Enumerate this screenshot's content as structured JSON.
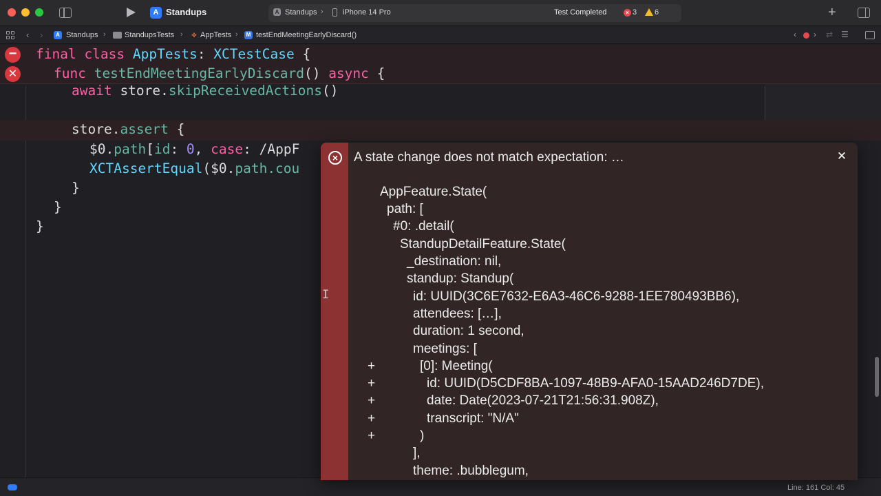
{
  "titlebar": {
    "project": "Standups",
    "scheme": "Standups",
    "device": "iPhone 14 Pro",
    "status": "Test Completed",
    "errors": "3",
    "warnings": "6"
  },
  "jumpbar": {
    "crumbs": [
      "Standups",
      "StandupsTests",
      "AppTests",
      "testEndMeetingEarlyDiscard()"
    ]
  },
  "code": {
    "line1": {
      "kw": "final class ",
      "type": "AppTests",
      "colon": ": ",
      "super": "XCTestCase",
      "brace": " {"
    },
    "line2": {
      "kw": "func ",
      "fn": "testEndMeetingEarlyDiscard",
      "paren": "() ",
      "async": "async",
      "brace": " {"
    },
    "line3": {
      "kw": "await ",
      "obj": "store.",
      "fn": "skipReceivedActions",
      "rest": "()"
    },
    "line4": {
      "obj": "store.",
      "fn": "assert",
      "rest": " {"
    },
    "line5": {
      "a": "$0.",
      "b": "path",
      "c": "[",
      "d": "id",
      "e": ": ",
      "f": "0",
      "g": ", ",
      "h": "case",
      "i": ": /AppF"
    },
    "line6": {
      "fn": "XCTAssertEqual",
      "rest": "($0.",
      "b": "path",
      "c": ".cou"
    },
    "line7": "}",
    "line8": "}",
    "line9": "}"
  },
  "popover": {
    "title": "A state change does not match expectation: …",
    "lines": [
      "AppFeature.State(",
      "path: [",
      "#0: .detail(",
      "StandupDetailFeature.State(",
      "_destination: nil,",
      "standup: Standup(",
      "id: UUID(3C6E7632-E6A3-46C6-9288-1EE780493BB6),",
      "attendees: […],",
      "duration: 1 second,",
      "meetings: [",
      "[0]: Meeting(",
      "id: UUID(D5CDF8BA-1097-48B9-AFA0-15AAD246D7DE),",
      "date: Date(2023-07-21T21:56:31.908Z),",
      "transcript: \"N/A\"",
      ")",
      "],",
      "theme: .bubblegum,"
    ],
    "plus": "+"
  },
  "statusbar": {
    "position": "Line: 161  Col: 45"
  },
  "colors": {
    "error": "#d9383f",
    "warning": "#f3bb26",
    "accent": "#2f7cf6",
    "popover_stripe": "#8c3233"
  },
  "icons": [
    "sidebar-toggle-icon",
    "run-icon",
    "error-icon",
    "warning-icon",
    "add-icon",
    "inspector-toggle-icon",
    "close-icon",
    "ibeam-cursor-icon"
  ]
}
